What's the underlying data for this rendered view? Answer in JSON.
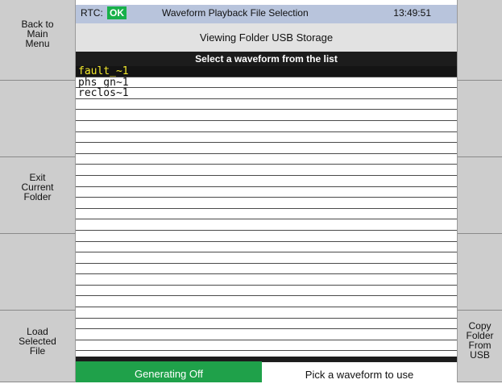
{
  "header": {
    "rtc_label": "RTC:",
    "rtc_status": "OK",
    "title": "Waveform Playback File Selection",
    "time": "13:49:51"
  },
  "folder_label": "Viewing Folder USB Storage",
  "list_prompt": "Select a waveform from the list",
  "files": [
    "fault_~1",
    "phs_gn~1",
    "reclos~1"
  ],
  "left_softkeys": [
    "Back to\nMain\nMenu",
    "",
    "Exit\nCurrent\nFolder",
    "",
    "Load\nSelected\nFile"
  ],
  "right_softkeys": [
    "",
    "",
    "",
    "",
    "Copy\nFolder\nFrom USB"
  ],
  "footer": {
    "generation_status": "Generating Off",
    "hint": "Pick a waveform to use"
  },
  "colors": {
    "rtc_ok": "#17b04a",
    "selected_text": "#f3e92d",
    "status_bar": "#b8c4dc",
    "generation_bg": "#1fa14a"
  }
}
